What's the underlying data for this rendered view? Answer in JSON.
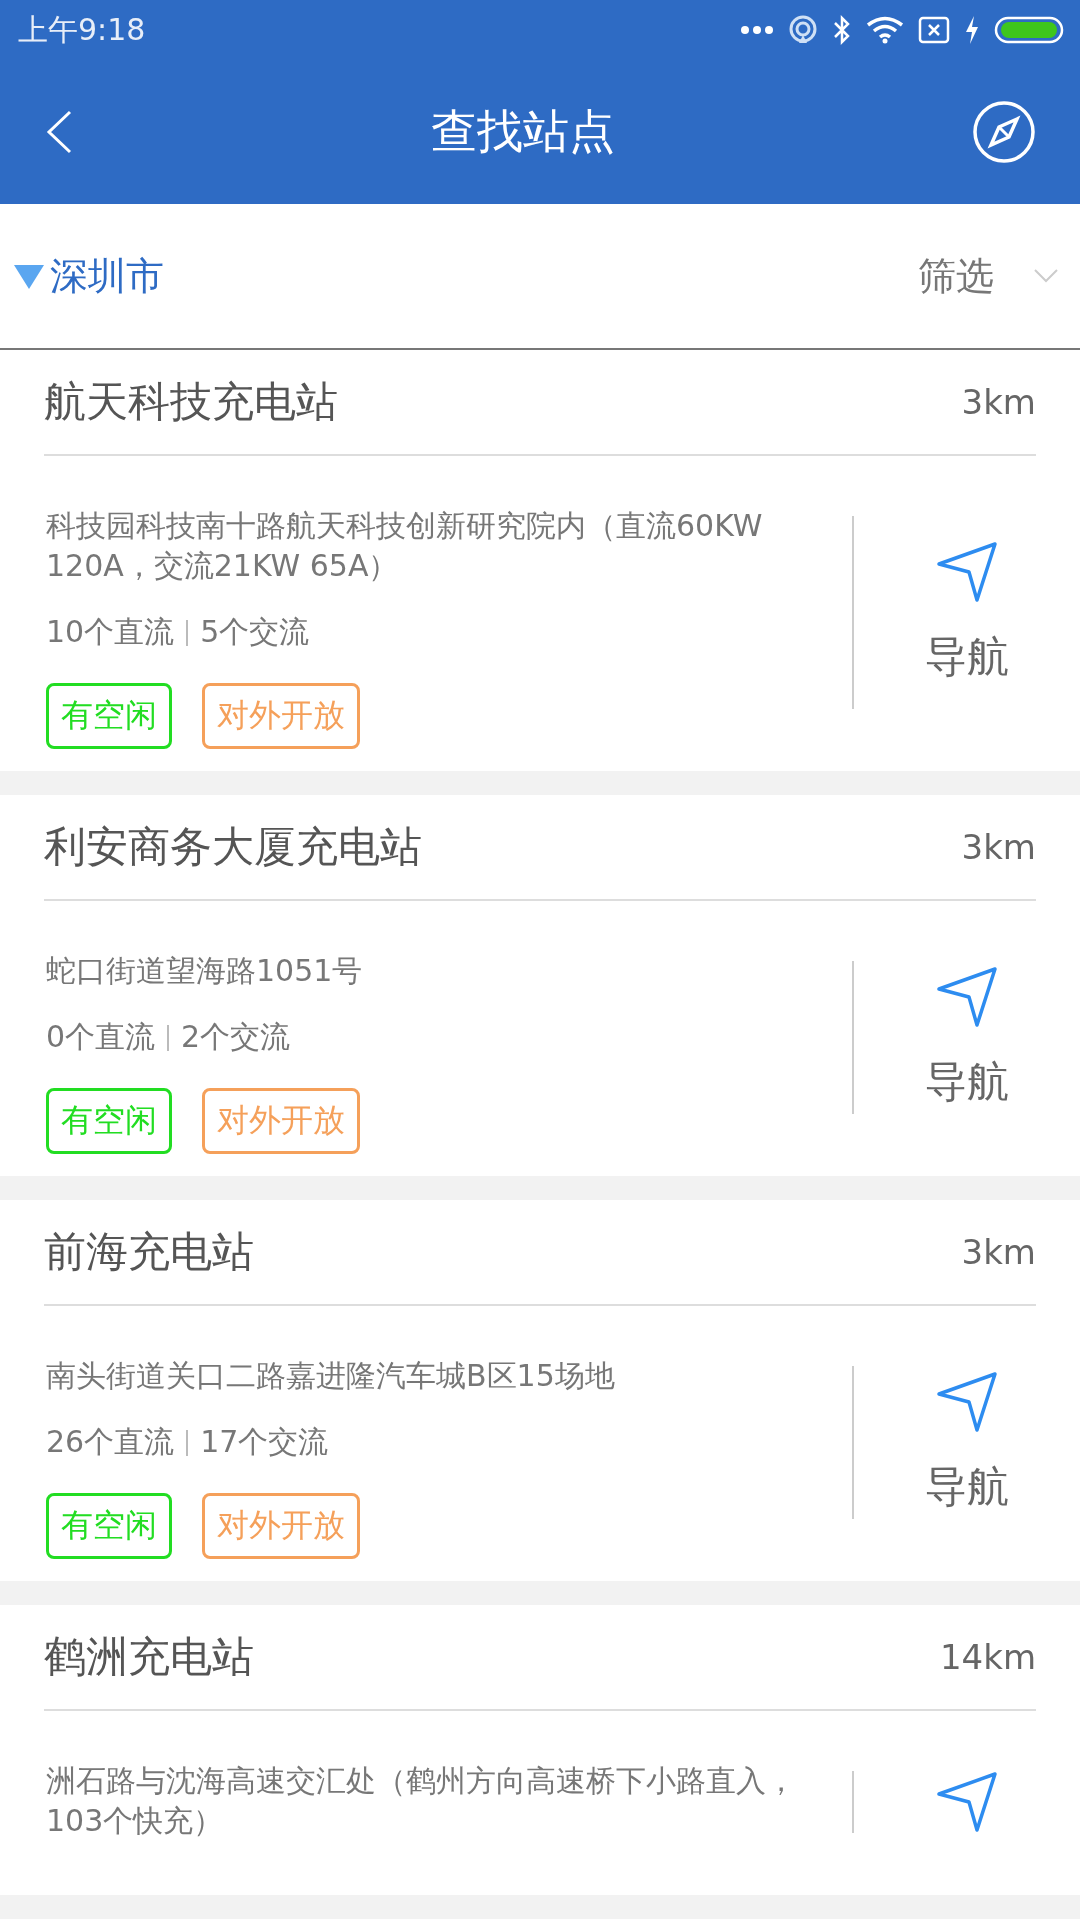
{
  "status_bar": {
    "time": "上午9:18"
  },
  "header": {
    "title": "查找站点"
  },
  "filter_bar": {
    "city": "深圳市",
    "filter_label": "筛选"
  },
  "stations": [
    {
      "name": "航天科技充电站",
      "distance": "3km",
      "address": "科技园科技南十路航天科技创新研究院内（直流60KW 120A，交流21KW 65A）",
      "dc_count": "10个直流",
      "ac_count": "5个交流",
      "tags": [
        {
          "label": "有空闲",
          "color": "#22dd22"
        },
        {
          "label": "对外开放",
          "color": "#f5a05a"
        }
      ],
      "nav_label": "导航"
    },
    {
      "name": "利安商务大厦充电站",
      "distance": "3km",
      "address": "蛇口街道望海路1051号",
      "dc_count": "0个直流",
      "ac_count": "2个交流",
      "tags": [
        {
          "label": "有空闲",
          "color": "#22dd22"
        },
        {
          "label": "对外开放",
          "color": "#f5a05a"
        }
      ],
      "nav_label": "导航"
    },
    {
      "name": "前海充电站",
      "distance": "3km",
      "address": "南头街道关口二路嘉进隆汽车城B区15场地",
      "dc_count": "26个直流",
      "ac_count": "17个交流",
      "tags": [
        {
          "label": "有空闲",
          "color": "#22dd22"
        },
        {
          "label": "对外开放",
          "color": "#f5a05a"
        }
      ],
      "nav_label": "导航"
    },
    {
      "name": "鹤洲充电站",
      "distance": "14km",
      "address": "洲石路与沈海高速交汇处（鹤州方向高速桥下小路直入，103个快充）"
    }
  ]
}
